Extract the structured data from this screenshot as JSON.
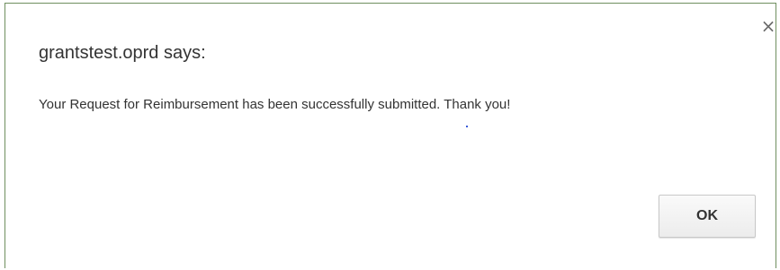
{
  "dialog": {
    "title": "grantstest.oprd says:",
    "message": "Your Request for Reimbursement has been successfully submitted.  Thank you!",
    "close_glyph": "×",
    "close_icon": "close-icon",
    "ok_label": "OK"
  }
}
